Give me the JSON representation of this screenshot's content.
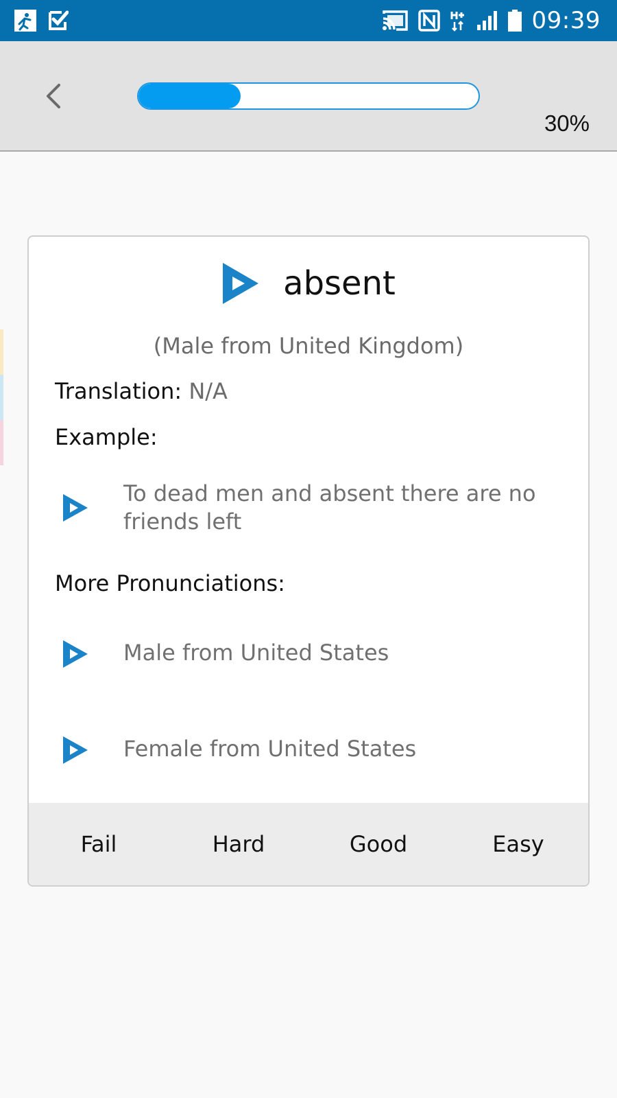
{
  "status_bar": {
    "time": "09:39",
    "left_icons": [
      "runner-app-icon",
      "checkmark-app-icon"
    ],
    "right_icons": [
      "cast-icon",
      "nfc-icon",
      "hplus-data-icon",
      "signal-icon",
      "battery-icon"
    ],
    "background_color": "#066fad"
  },
  "toolbar": {
    "back_icon": "chevron-left-icon",
    "progress_percent": 30,
    "progress_label": "30%",
    "accent_color": "#049cf0"
  },
  "card": {
    "word": "absent",
    "speaker": "(Male from United Kingdom)",
    "translation_label": "Translation:",
    "translation_value": "N/A",
    "example_label": "Example:",
    "example_text": "To dead men and absent there are no friends left",
    "more_label": "More Pronunciations:",
    "pronunciations": [
      {
        "label": "Male from United States"
      },
      {
        "label": "Female from United States"
      }
    ],
    "play_icon": "play-icon",
    "play_icon_color": "#1b84c8"
  },
  "rating": {
    "buttons": [
      "Fail",
      "Hard",
      "Good",
      "Easy"
    ]
  }
}
